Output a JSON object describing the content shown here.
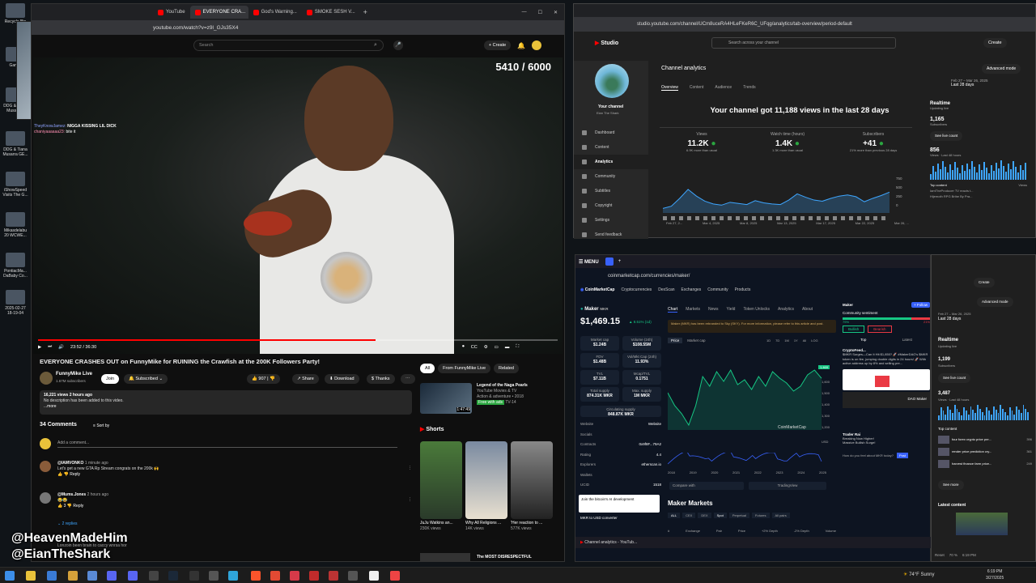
{
  "desktop": {
    "icons": [
      {
        "label": "Recycle Bin",
        "top": 4
      },
      {
        "label": "Gam...",
        "top": 58
      },
      {
        "label": "DDG & Tiana Mussari...",
        "top": 108
      },
      {
        "label": "DDG & Tiana Musarra GE...",
        "top": 162
      },
      {
        "label": "iShowSpeed Visits The G...",
        "top": 212
      },
      {
        "label": "Mikasdelabu 20 WCWE...",
        "top": 262
      },
      {
        "label": "PontiacMa... DaBaby Co...",
        "top": 312
      },
      {
        "label": "2025-02-27 18-19-04",
        "top": 358
      }
    ]
  },
  "left_browser": {
    "tabs": [
      "YouTube",
      "EVERYONE CRA...",
      "God's Warning...",
      "SMOKE SESH V..."
    ],
    "url": "youtube.com/watch?v=z9l_GJs35X4",
    "search_placeholder": "Search",
    "create_label": "Create",
    "goal_counter": "5410 / 6000",
    "time": "23:52 / 36:30",
    "progress_fraction": 0.65,
    "chat": [
      {
        "user": "TheyKnowJamez:",
        "text": "NIGGA KISSING LIL DICK"
      },
      {
        "user": "chaniyaaaaaa23:",
        "text": "bite it"
      }
    ],
    "video_title": "EVERYONE CRASHES OUT on FunnyMike for RUINING the Crawfish at the 200K Followers Party!",
    "channel_name": "FunnyMike Live",
    "subscribers": "1.67M subscribers",
    "join": "Join",
    "subscribed": "Subscribed",
    "likes": "907",
    "share": "Share",
    "download": "Download",
    "thanks": "Thanks",
    "desc_line1": "16,221 views  2 hours ago",
    "desc_line2": "No description has been added to this video.",
    "desc_more": "...more",
    "comments_count": "34 Comments",
    "sort_by": "Sort by",
    "add_comment": "Add a comment...",
    "comments": [
      {
        "user": "@IAMVONKO",
        "time": "1 minute ago",
        "text": "Let's get a new GTA Rp Stream  congrats on the 200k 🙌",
        "reply": "Reply"
      },
      {
        "user": "@Mums.Jones",
        "time": "2 hours ago",
        "text": "😂😂",
        "reply": "Reply",
        "likes": "3"
      }
    ],
    "replies_label": "2 replies",
    "partial_comment": "Lonzoin been brain to caccy wnrsa hor",
    "filters": [
      "All",
      "From FunnyMike Live",
      "Related"
    ],
    "rec_title": "Legend of the Naga Pearls",
    "rec_channel": "YouTube Movies & TV",
    "rec_meta": "Action & adventure • 2018",
    "rec_badge": "Free with ads",
    "rec_rating": "TV-14",
    "rec_duration": "1:47:49",
    "shorts_label": "Shorts",
    "shorts": [
      {
        "title": "JuJu Watkins an...",
        "views": "230K views"
      },
      {
        "title": "Why All Religions ...",
        "views": "14K views"
      },
      {
        "title": "'Her reaction to ...",
        "views": "577K views"
      }
    ],
    "bottom_rec": "The MOST DISRESPECTFUL"
  },
  "overlay": {
    "line1": "@HeavenMadeHim",
    "line2": "@EianTheShark"
  },
  "studio": {
    "url": "studio.youtube.com/channel/UCm8uceRA4HLeFKeR6C_UFqg/analytics/tab-overview/period-default",
    "logo": "Studio",
    "search_placeholder": "Search across your channel",
    "create": "Create",
    "page_title": "Channel analytics",
    "advanced": "Advanced mode",
    "tabs": [
      "Overview",
      "Content",
      "Audience",
      "Trends"
    ],
    "date_range": "Feb 27 – Mar 26, 2025",
    "date_label": "Last 28 days",
    "your_channel": "Your channel",
    "channel_sub": "Eian The Shark",
    "nav": [
      "Dashboard",
      "Content",
      "Analytics",
      "Community",
      "Subtitles",
      "Copyright",
      "Settings",
      "Send feedback"
    ],
    "headline": "Your channel got 11,188 views in the last 28 days",
    "stats": [
      {
        "label": "Views",
        "value": "11.2K",
        "note": "6.9K more than usual"
      },
      {
        "label": "Watch time (hours)",
        "value": "1.4K",
        "note": "1.3K more than usual"
      },
      {
        "label": "Subscribers",
        "value": "+41",
        "note": "21% more than previous 28 days"
      }
    ],
    "y_ticks": [
      "750",
      "500",
      "250",
      "0"
    ],
    "x_ticks": [
      "Feb 27, 2...",
      "Mar 4, 2025",
      "Mar 8, 2025",
      "Mar 13, 2025",
      "Mar 17, 2025",
      "Mar 22, 2025",
      "Mar 26, ..."
    ],
    "chart_values": [
      80,
      120,
      260,
      420,
      300,
      210,
      160,
      140,
      190,
      170,
      150,
      220,
      180,
      160,
      150,
      230,
      340,
      280,
      230,
      210,
      260,
      300,
      320,
      290,
      200,
      260,
      310,
      370
    ],
    "realtime_title": "Realtime",
    "realtime_sub": "Updating live",
    "rt_subs": "1,165",
    "rt_subs_label": "Subscribers",
    "see_live": "See live count",
    "rt_views": "856",
    "rt_views_label": "Views · Last 48 hours",
    "top_content": "Top content",
    "top_views_label": "Views",
    "top_items": [
      "IamTheProducer TV reacts t...",
      "Hijemoth RPG Bribe By Pra..."
    ]
  },
  "cmc": {
    "menu": "MENU",
    "url": "coinmarketcap.com/currencies/maker/",
    "brand": "CoinMarketCap",
    "nav": [
      "Cryptocurrencies",
      "DexScan",
      "Exchanges",
      "Community",
      "Products"
    ],
    "coin": "Maker",
    "symbol": "MKR",
    "price": "$1,469.15",
    "change": "▲ 8.51% (1d)",
    "cards": [
      {
        "label": "Market cap",
        "value": "$1.24B"
      },
      {
        "label": "Volume (24h)",
        "value": "$108.55M"
      },
      {
        "label": "FDV",
        "value": "$1.48B"
      },
      {
        "label": "Vol/Mkt Cap (24h)",
        "value": "11.93%"
      },
      {
        "label": "TVL",
        "value": "$7.11B"
      },
      {
        "label": "Mcap/TVL",
        "value": "0.1751"
      },
      {
        "label": "Total supply",
        "value": "874.31K MKR"
      },
      {
        "label": "Max. supply",
        "value": "1M MKR"
      }
    ],
    "circ_label": "Circulating supply",
    "circ_value": "848.87K MKR",
    "chart_tabs": [
      "Chart",
      "Markets",
      "News",
      "Yield",
      "Token Unlocks",
      "Analytics",
      "About"
    ],
    "notice": "Maker (MKR) has been rebranded to Sky (SKY). For more information, please refer to this article and post.",
    "price_btn": "Price",
    "mcap_btn": "Market cap",
    "ranges": [
      "1D",
      "7D",
      "1M",
      "1Y",
      "All",
      "LOG"
    ],
    "price_axis": [
      "1,600",
      "1,500",
      "1,400",
      "1,300",
      "1,200"
    ],
    "price_values": [
      1380,
      1300,
      1250,
      1180,
      1300,
      1480,
      1420,
      1510,
      1450,
      1520,
      1430,
      1460,
      1400,
      1480,
      1420,
      1510,
      1470,
      1440,
      1390,
      1420,
      1490,
      1520,
      1469
    ],
    "last_price_tag": "1,469",
    "watermark": "CoinMarketCap",
    "currency": "USD",
    "x_years": [
      "2018",
      "2019",
      "2020",
      "2021",
      "2022",
      "2023",
      "2024",
      "2025"
    ],
    "rows": [
      {
        "label": "Website",
        "value": "Website"
      },
      {
        "label": "Socials",
        "value": ""
      },
      {
        "label": "Contracts",
        "value": "0x9f8F...79A2"
      },
      {
        "label": "Rating",
        "value": "4.4"
      },
      {
        "label": "Explorers",
        "value": "etherscan.io"
      },
      {
        "label": "Wallets",
        "value": ""
      },
      {
        "label": "UCID",
        "value": "1518"
      }
    ],
    "compare": "Compare with",
    "tradingview": "TradingView",
    "ad_text": "Join the bitcoin's AI development",
    "converter": "MKR to USD converter",
    "markets_title": "Maker Markets",
    "market_filters": [
      "ALL",
      "CEX",
      "DEX",
      "Spot",
      "Perpetual",
      "Futures",
      "All pairs"
    ],
    "table_headers": [
      "#",
      "Exchange",
      "Pair",
      "Price",
      "+2% Depth",
      "-2% Depth",
      "Volume"
    ],
    "social_user": "Maker",
    "social_follow": "+ Follow",
    "sentiment": "Community sentiment",
    "bullish_pct": "79%",
    "bearish_pct": "21%",
    "bullish": "Bullish",
    "bearish": "Bearish",
    "top": "Top",
    "latest": "Latest",
    "post_user": "CryptoFeed...",
    "post_text": "$MKR Surges—Can It Hit $1,850? 🚀 #MakerDAO's $MKR token is on fire, jumping double digits in 24 hours! 🚀 With active address up by 8% and selling pre...",
    "post2_user": "Trader Rai",
    "post2_text": "Breaking Now Higher!",
    "post2_sub": "Massive Bullish Surge!",
    "dao_maker": "DAO Maker",
    "win_tab": "Channel analytics - YouTub...",
    "post_btn": "Post",
    "how_feel": "How do you feel about MKR today?"
  },
  "studio2": {
    "create": "Create",
    "advanced": "Advanced mode",
    "date_range": "Feb 27 – Mar 26, 2025",
    "date_label": "Last 28 days",
    "realtime": "Realtime",
    "realtime_sub": "Updating live",
    "subs": "1,199",
    "subs_label": "Subscribers",
    "see_live": "See live count",
    "views": "3,487",
    "views_label": "Views · Last 48 hours",
    "top_content": "Top content",
    "top_items": [
      {
        "title": "four forex crypto price pre...",
        "views": "396"
      },
      {
        "title": "render price prediction cry...",
        "views": "361"
      },
      {
        "title": "harvest finance farm price...",
        "views": "249"
      }
    ],
    "see_more": "See more",
    "latest": "Latest content",
    "reset": "Reset",
    "zoom": "70 %",
    "clock": "6:19 PM"
  },
  "taskbar": {
    "weather": "74°F",
    "weather_desc": "Sunny",
    "time": "6:19 PM",
    "date": "3/27/2025"
  }
}
